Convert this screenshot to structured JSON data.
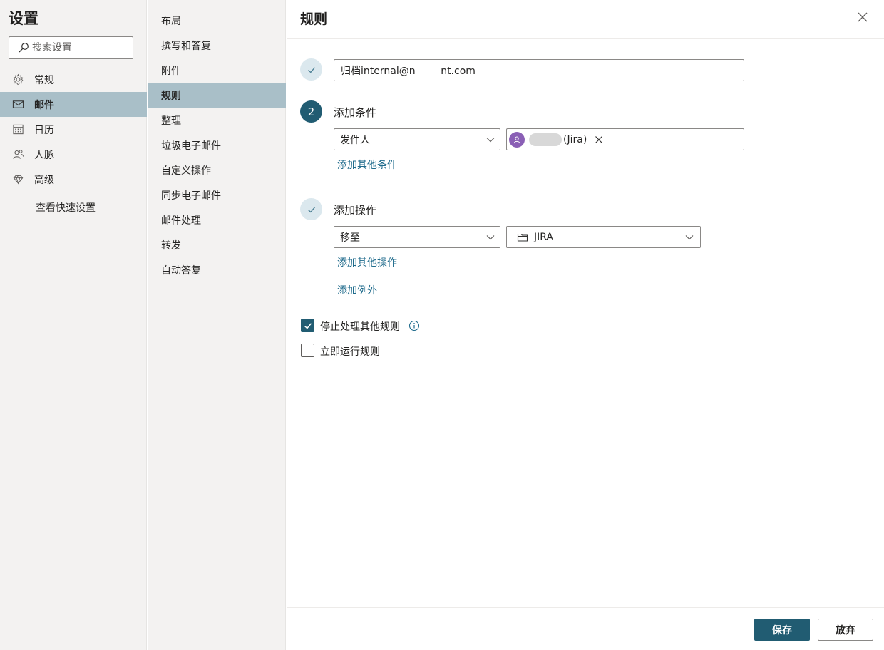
{
  "settings_title": "设置",
  "search": {
    "placeholder": "搜索设置"
  },
  "nav1": {
    "items": [
      {
        "label": "常规",
        "icon": "gear-icon"
      },
      {
        "label": "邮件",
        "icon": "mail-icon",
        "active": true
      },
      {
        "label": "日历",
        "icon": "calendar-icon"
      },
      {
        "label": "人脉",
        "icon": "people-icon"
      },
      {
        "label": "高级",
        "icon": "diamond-icon"
      }
    ],
    "quick_settings": "查看快速设置"
  },
  "nav2": {
    "items": [
      {
        "label": "布局"
      },
      {
        "label": "撰写和答复"
      },
      {
        "label": "附件"
      },
      {
        "label": "规则",
        "active": true
      },
      {
        "label": "整理"
      },
      {
        "label": "垃圾电子邮件"
      },
      {
        "label": "自定义操作"
      },
      {
        "label": "同步电子邮件"
      },
      {
        "label": "邮件处理"
      },
      {
        "label": "转发"
      },
      {
        "label": "自动答复"
      }
    ]
  },
  "main": {
    "title": "规则",
    "rule_name": "归档internal@n        nt.com",
    "condition_step_number": "2",
    "condition_label": "添加条件",
    "condition_field": "发件人",
    "condition_value": "(Jira)",
    "add_condition": "添加其他条件",
    "action_label": "添加操作",
    "action_field": "移至",
    "action_folder": "JIRA",
    "add_action": "添加其他操作",
    "add_exception": "添加例外",
    "stop_processing": {
      "label": "停止处理其他规则",
      "checked": true
    },
    "run_now": {
      "label": "立即运行规则",
      "checked": false
    },
    "save": "保存",
    "discard": "放弃"
  },
  "colors": {
    "accent": "#215c72",
    "active_bg": "#a9bfc8",
    "link": "#1f6b8c",
    "avatar": "#8a5fb5"
  }
}
